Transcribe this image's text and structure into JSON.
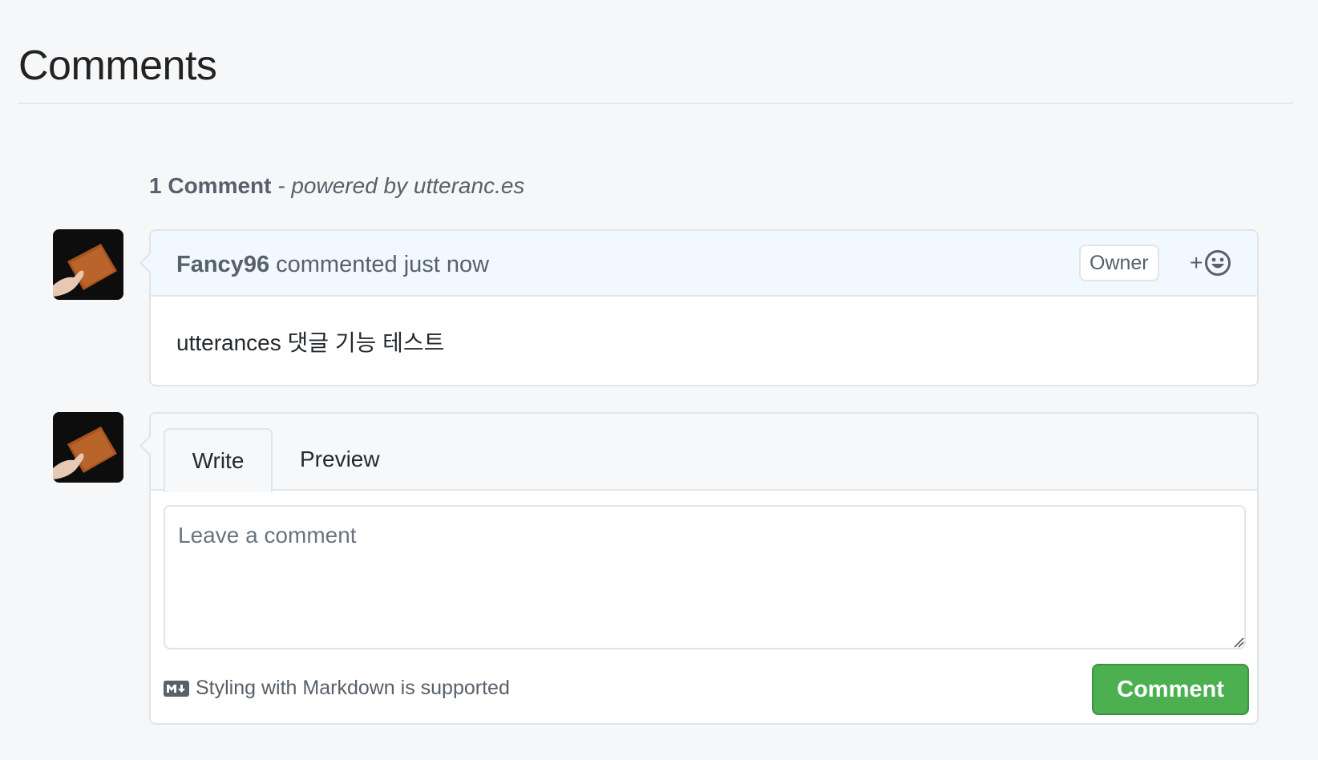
{
  "page": {
    "title": "Comments"
  },
  "thread": {
    "count_label": "1 Comment",
    "powered_by": "- powered by utteranc.es"
  },
  "comment": {
    "author": "Fancy96",
    "action": "commented just now",
    "badge": "Owner",
    "reaction_plus": "+",
    "body": "utterances 댓글 기능 테스트"
  },
  "composer": {
    "tabs": [
      "Write",
      "Preview"
    ],
    "active_tab": "Write",
    "placeholder": "Leave a comment",
    "value": "",
    "markdown_note": "Styling with Markdown is supported",
    "submit_label": "Comment"
  },
  "colors": {
    "submit_green": "#4caf50",
    "header_blue": "#f1f8ff",
    "border": "#e1e4e8"
  }
}
